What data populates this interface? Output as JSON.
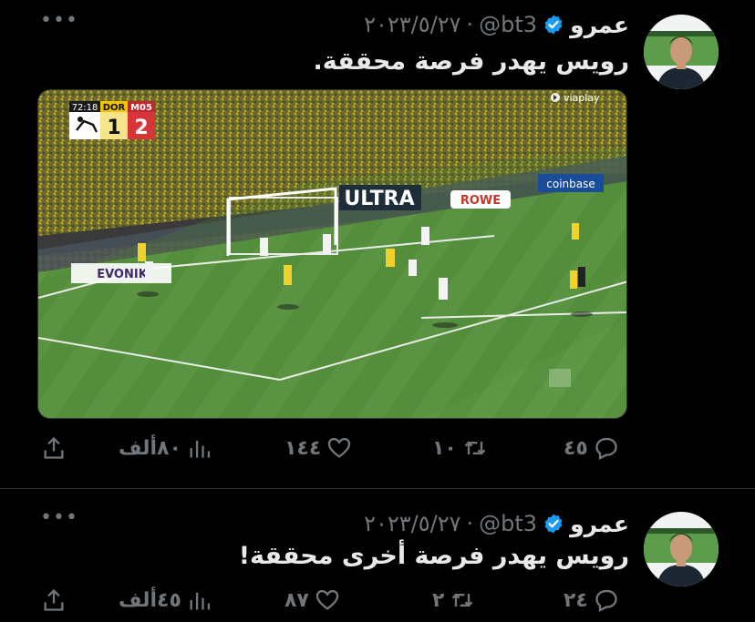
{
  "tweets": [
    {
      "author_name": "عمرو",
      "handle": "@bt3",
      "separator": "·",
      "date": "٢٠٢٣/٥/٢٧",
      "text": "رويس يهدر فرصة محققة.",
      "more": "•••",
      "media": {
        "clock": "72:18",
        "home_team": "DOR",
        "away_team": "M05",
        "home_score": "1",
        "away_score": "2",
        "broadcaster": "viaplay",
        "boards": [
          "ULTRA",
          "ROWE",
          "coinbase",
          "EVONIK"
        ]
      },
      "stats": {
        "replies": "٤٥",
        "retweets": "١٠",
        "likes": "١٤٤",
        "views": "٨٠ألف"
      }
    },
    {
      "author_name": "عمرو",
      "handle": "@bt3",
      "separator": "·",
      "date": "٢٠٢٣/٥/٢٧",
      "text": "رويس يهدر فرصة أخرى محققة!",
      "more": "•••",
      "stats": {
        "replies": "٢٤",
        "retweets": "٢",
        "likes": "٨٧",
        "views": "٤٥ألف"
      }
    }
  ],
  "colors": {
    "background": "#000000",
    "secondary_text": "#71767b",
    "verified": "#1d9bf0",
    "divider": "#2f3336"
  },
  "icons": [
    "verified-badge-icon",
    "more-icon",
    "reply-icon",
    "retweet-icon",
    "like-icon",
    "views-icon",
    "share-icon"
  ]
}
